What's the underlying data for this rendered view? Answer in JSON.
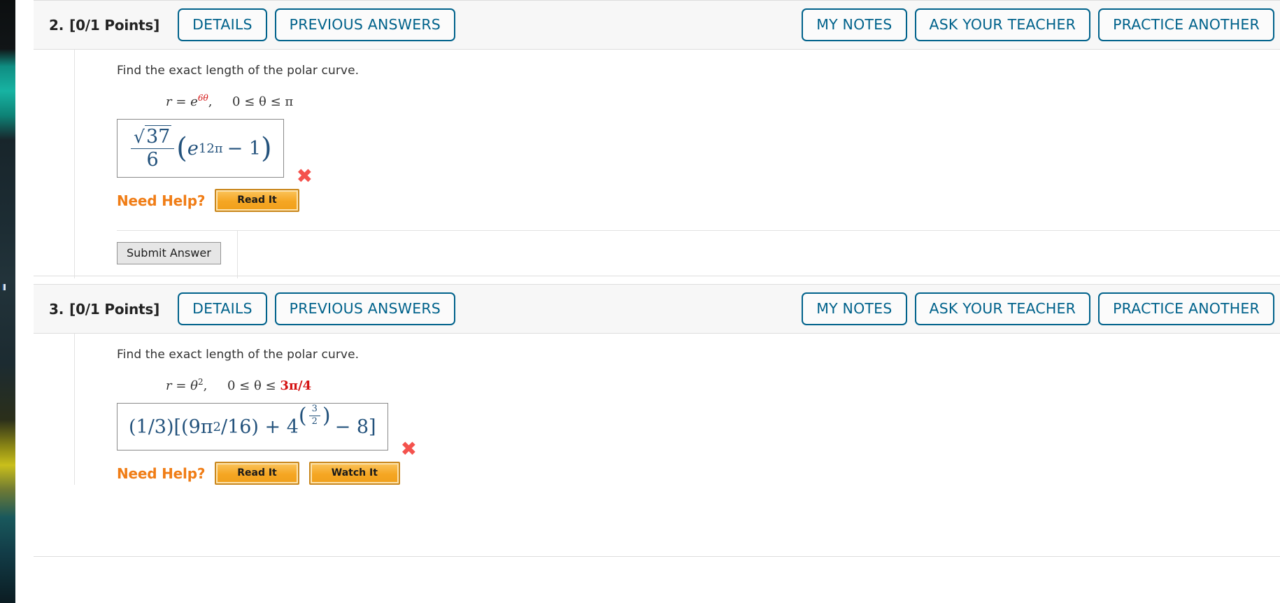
{
  "page": {
    "platform_note": "WebAssign style online homework viewer",
    "accent_blue": "#00628b",
    "orange": "#f07d16",
    "error_red": "#f4524d",
    "math_blue": "#23527c"
  },
  "buttons_common": {
    "details": "DETAILS",
    "previous_answers": "PREVIOUS ANSWERS",
    "my_notes": "MY NOTES",
    "ask_your_teacher": "ASK YOUR TEACHER",
    "practice_another": "PRACTICE ANOTHER",
    "need_help_label": "Need Help?",
    "read_it": "Read It",
    "watch_it": "Watch It",
    "submit_answer": "Submit Answer",
    "wrong_mark": "✖"
  },
  "questions": [
    {
      "number": "2.",
      "points": "[0/1 Points]",
      "prompt": "Find the exact length of the polar curve.",
      "equation": {
        "variable": "r",
        "equals": "=",
        "base": "e",
        "exponent": "6θ",
        "comma": ",",
        "domain": "0 ≤ θ ≤ π",
        "domain_highlight": ""
      },
      "answer": {
        "plain": "(√37/6)(e^(12π) − 1)",
        "sqrt_radicand": "37",
        "denominator": "6",
        "inner_base": "e",
        "inner_exponent": "12π",
        "inner_tail": "− 1",
        "status": "incorrect"
      },
      "help_buttons": [
        "Read It"
      ],
      "has_submit": true
    },
    {
      "number": "3.",
      "points": "[0/1 Points]",
      "prompt": "Find the exact length of the polar curve.",
      "equation": {
        "variable": "r",
        "equals": "=",
        "base": "θ",
        "exponent": "2",
        "comma": ",",
        "domain": "0 ≤ θ ≤ ",
        "domain_highlight": "3π/4"
      },
      "answer": {
        "plain": "(1/3)[(9π^2/16) + 4^(3/2) − 8]",
        "lead": "(1/3)[(9π",
        "lead_sup": "2",
        "mid": "/16) + 4",
        "exp_num": "3",
        "exp_den": "2",
        "tail": "− 8]",
        "status": "incorrect"
      },
      "help_buttons": [
        "Read It",
        "Watch It"
      ],
      "has_submit": false
    }
  ]
}
